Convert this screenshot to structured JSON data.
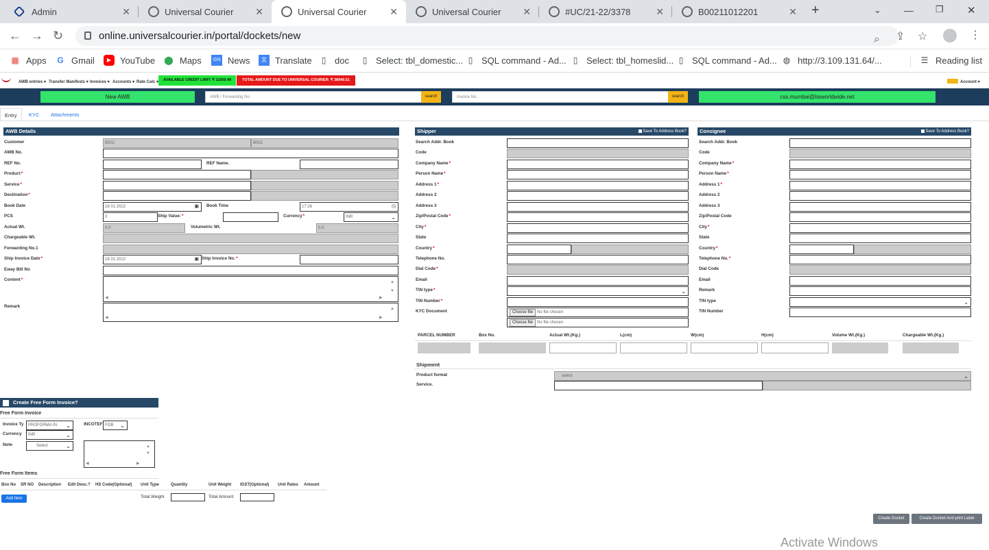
{
  "browser": {
    "tabs": [
      {
        "title": "Admin",
        "active": false
      },
      {
        "title": "Universal Courier",
        "active": false
      },
      {
        "title": "Universal Courier",
        "active": true
      },
      {
        "title": "Universal Courier",
        "active": false
      },
      {
        "title": "#UC/21-22/3378",
        "active": false
      },
      {
        "title": "B00211012201",
        "active": false
      }
    ],
    "new_tab": "+",
    "url": "online.universalcourier.in/portal/dockets/new",
    "bookmarks": [
      "Apps",
      "Gmail",
      "YouTube",
      "Maps",
      "News",
      "Translate",
      "doc",
      "Select: tbl_domestic...",
      "SQL command - Ad...",
      "Select: tbl_homeslid...",
      "SQL command - Ad...",
      "http://3.109.131.64/..."
    ],
    "reading_list": "Reading list"
  },
  "header": {
    "menus": [
      "AWB entries",
      "Transfer Manifests",
      "Invoices",
      "Accounts",
      "Rate Calc"
    ],
    "credit_limit": "AVAILABLE CREDIT LIMIT: ₹ 11059.49",
    "amount_due": "TOTAL AMOUNT DUE TO UNIVERSAL COURIER: ₹ 38940.51",
    "account": "Account",
    "new_awb": "New AWB",
    "awb_search_placeholder": "AWB / Forwarding No.",
    "invoice_search_placeholder": "Invoice No.",
    "search_label": "search",
    "user_email": "css.mumbai@bsworldwide.net"
  },
  "page_tabs": [
    "Entry",
    "KYC",
    "Attachments"
  ],
  "awb": {
    "title": "AWB Details",
    "customer_label": "Customer",
    "customer_code": "B002",
    "customer_name": "B002",
    "awb_no_label": "AWB No.",
    "ref_no_label": "REF No.",
    "ref_name_label": "REF Name.",
    "product_label": "Product",
    "service_label": "Service",
    "destination_label": "Destination",
    "book_date_label": "Book Date",
    "book_date": "18  01  2022",
    "book_time_label": "Book Time",
    "book_time": "17:26",
    "pcs_label": "PCS",
    "pcs": "0",
    "ship_value_label": "Ship Value:",
    "currency_label": "Currency",
    "currency": "INR",
    "actual_wt_label": "Actual Wt.",
    "actual_wt": "0.0",
    "vol_wt_label": "Volumetric Wt.",
    "vol_wt": "0.0",
    "chargeable_wt_label": "Chargeable Wt.",
    "forwarding_label": "Forwarding No.1",
    "ship_invoice_date_label": "Ship Invoice Date",
    "ship_invoice_date": "18  01  2022",
    "ship_invoice_no_label": "Ship Invoice No.",
    "eway_label": "Eway Bill No",
    "content_label": "Content",
    "remark_label": "Remark"
  },
  "shipper": {
    "title": "Shipper",
    "save_label": "Save To Address Book?",
    "fields": [
      "Search Addr. Book",
      "Code",
      "Company Name",
      "Person Name",
      "Address 1",
      "Address 2",
      "Address 3",
      "Zip/Postal Code",
      "City",
      "State",
      "Country",
      "Telephone No.",
      "Dial Code",
      "Email",
      "TIN type",
      "TIN Number",
      "KYC Document"
    ],
    "choose_file": "Choose file",
    "no_file": "No file chosen"
  },
  "consignee": {
    "title": "Consignee",
    "save_label": "Save To Address Book?",
    "fields": [
      "Search Addr. Book",
      "Code",
      "Company Name",
      "Person Name",
      "Address 1",
      "Address 2",
      "Address 3",
      "Zip/Postal Code",
      "City",
      "State",
      "Country",
      "Telephone No.",
      "Dial Code",
      "Email",
      "Remark",
      "TIN type",
      "TIN Number"
    ]
  },
  "parcel": {
    "headers": [
      "PARCEL NUMBER",
      "Box No.",
      "Actual Wt.(Kg.)",
      "L(cm)",
      "W(cm)",
      "H(cm)",
      "Volume Wt.(Kg.)",
      "Chargeable Wt.(Kg.)"
    ]
  },
  "shipment": {
    "title": "Shipment",
    "product_format_label": "Product format",
    "product_format": "select",
    "service_label": "Service."
  },
  "invoice": {
    "create_label": "Create Free Form Invoice?",
    "section_title": "Free Form Invoice",
    "invoice_type_label": "Invoice Ty",
    "invoice_type": "PROFORMA IN",
    "incoterm_label": "INCOTEF",
    "incoterm": "FOB",
    "currency_label": "Currency",
    "currency": "INR",
    "note_label": "Note",
    "note": "Select",
    "items_title": "Free Form Items",
    "item_headers": [
      "Box No",
      "SR NO",
      "Description",
      "Edit Desc.?",
      "HS Code(Optional)",
      "Unit Type",
      "Quantity",
      "Unit Weight",
      "IGST(Optional)",
      "Unit Rates",
      "Amount"
    ],
    "add_item": "Add Item",
    "total_weight_label": "Total Weight",
    "total_amount_label": "Total Amount"
  },
  "actions": {
    "create_docket": "Create Docket",
    "create_docket_print": "Create Docket And print Label"
  },
  "os": {
    "watermark": "Activate Windows"
  },
  "colors": {
    "section_head": "#274867",
    "search_bar": "#1d3d5c",
    "green": "#33e36b",
    "credit": "#22e23a",
    "due": "#e61919",
    "search_btn": "#f3b415"
  }
}
